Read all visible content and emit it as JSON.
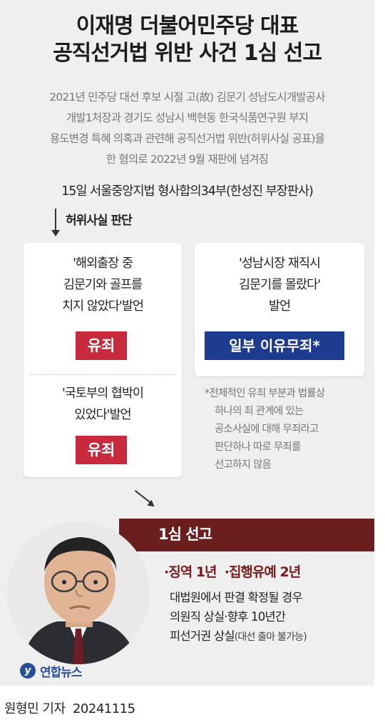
{
  "header": {
    "title_line1": "이재명 더불어민주당 대표",
    "title_line2": "공직선거법 위반 사건 1심 선고"
  },
  "background": {
    "lines": [
      "2021년 민주당 대선 후보 시절 고(故) 김문기 성남도시개발공사",
      "개발1처장과 경기도 성남시 백현동 한국식품연구원 부지",
      "용도변경 특혜 의혹과 관련해 공직선거법 위반(허위사실 공표)을",
      "한 혐의로 2022년 9월 재판에 넘겨짐"
    ]
  },
  "court": "15일 서울중앙지법 형사합의34부(한성진 부장판사)",
  "judgment_label": "허위사실 판단",
  "left_card": {
    "stmt1_lines": [
      "'해외출장 중",
      "김문기와 골프를",
      "치지 않았다'발언"
    ],
    "stmt1_result": "유죄",
    "stmt2_lines": [
      "'국토부의 협박이",
      "있었다'발언"
    ],
    "stmt2_result": "유죄"
  },
  "right_card": {
    "stmt_lines": [
      "'성남시장 재직시",
      "김문기를 몰랐다'",
      "발언"
    ],
    "result": "일부 이유무죄*"
  },
  "footnote": [
    "*전체적인 유죄 부분과 법률상",
    "하나의 죄 관계에 있는",
    "공소사실에 대해 무죄라고",
    "판단하나 따로 무죄를",
    "선고하지 않음"
  ],
  "verdict": {
    "title": "1심 선고",
    "sentence": "·징역 1년  ·집행유예 2년",
    "consequence_lines": [
      "대법원에서 판결 확정될 경우",
      "의원직 상실·향후 10년간"
    ],
    "consequence_last": "피선거권 상실",
    "consequence_note": "(대선 출마 불가능)"
  },
  "logo": {
    "mark": "y",
    "text": "연합뉴스"
  },
  "credit": "원형민 기자  20241115",
  "colors": {
    "guilty_badge": "#c8293d",
    "partial_badge": "#1d3c8f",
    "verdict_bar": "#6b1e1e",
    "panel_bg": "#efefef"
  }
}
